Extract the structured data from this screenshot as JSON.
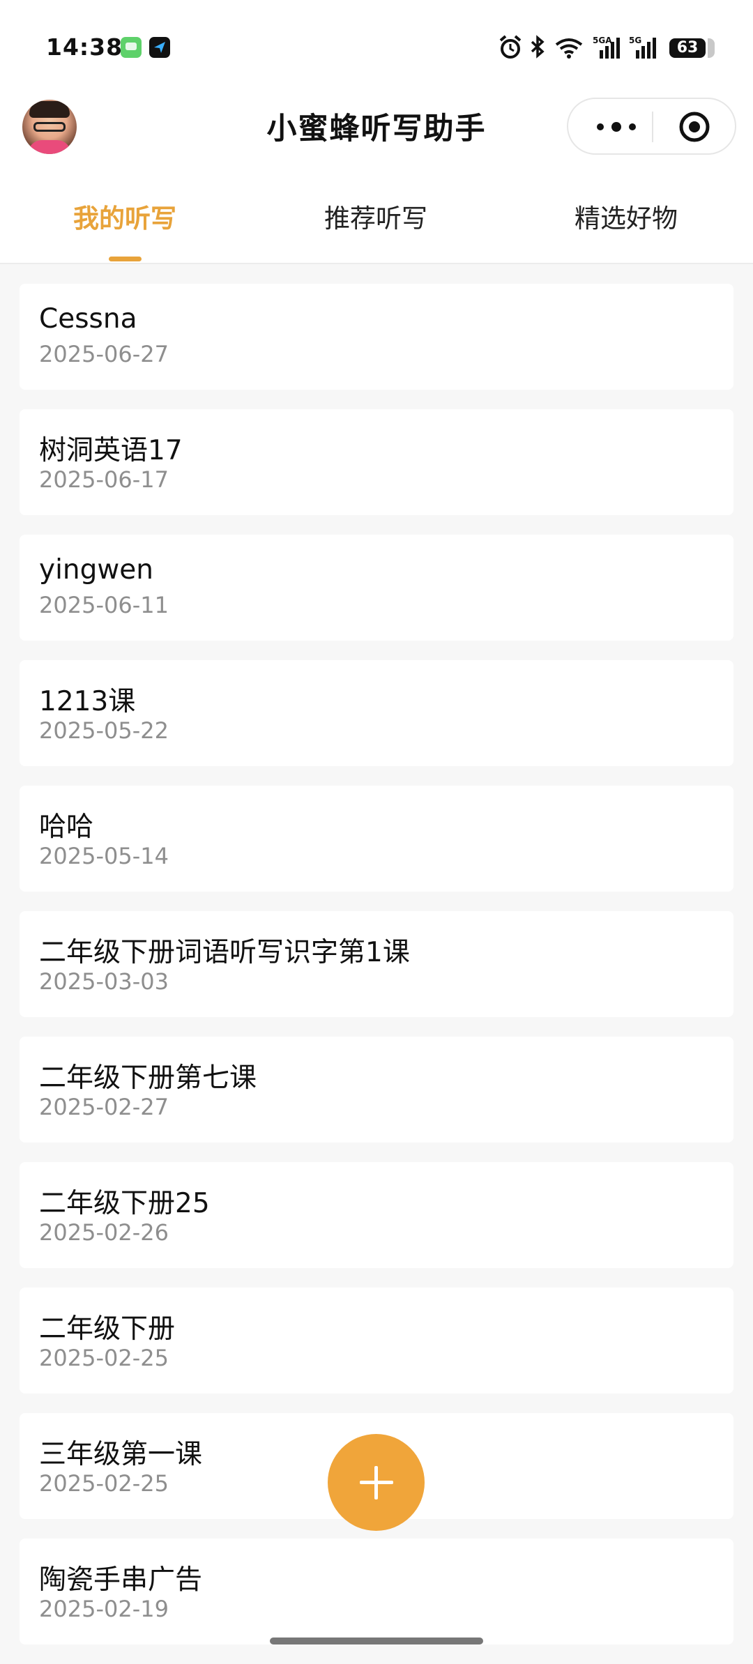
{
  "status_bar": {
    "time": "14:38",
    "battery": "63",
    "icons": [
      "messages-app-icon",
      "navigation-app-icon",
      "alarm-icon",
      "bluetooth-icon",
      "wifi-icon",
      "signal-5g-a-icon",
      "signal-5g-icon",
      "battery-icon"
    ]
  },
  "header": {
    "title": "小蜜蜂听写助手",
    "capsule_icons": [
      "more-icon",
      "close-mini-program-icon"
    ]
  },
  "tabs": [
    {
      "label": "我的听写",
      "active": true
    },
    {
      "label": "推荐听写",
      "active": false
    },
    {
      "label": "精选好物",
      "active": false
    }
  ],
  "dictations": [
    {
      "name": "Cessna",
      "date": "2025-06-27"
    },
    {
      "name": "树洞英语17",
      "date": "2025-06-17"
    },
    {
      "name": "yingwen",
      "date": "2025-06-11"
    },
    {
      "name": "1213课",
      "date": "2025-05-22"
    },
    {
      "name": "哈哈",
      "date": "2025-05-14"
    },
    {
      "name": "二年级下册词语听写识字第1课",
      "date": "2025-03-03"
    },
    {
      "name": "二年级下册第七课",
      "date": "2025-02-27"
    },
    {
      "name": "二年级下册25",
      "date": "2025-02-26"
    },
    {
      "name": "二年级下册",
      "date": "2025-02-25"
    },
    {
      "name": "三年级第一课",
      "date": "2025-02-25"
    },
    {
      "name": "陶瓷手串广告",
      "date": "2025-02-19"
    }
  ],
  "fab": {
    "icon": "plus-icon"
  },
  "colors": {
    "accent": "#e8a33a",
    "fab": "#f0a53a",
    "date_text": "#8e8e8e",
    "background": "#f7f7f7"
  }
}
